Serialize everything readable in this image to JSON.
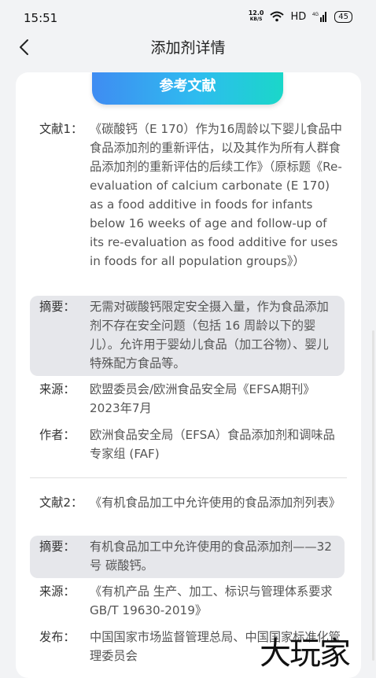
{
  "status": {
    "time": "15:51",
    "speed_top": "12.0",
    "speed_bottom": "KB/S",
    "hd": "HD",
    "net": "4G",
    "battery": "45"
  },
  "header": {
    "title": "添加剂详情"
  },
  "section": {
    "title": "参考文献"
  },
  "refs": [
    {
      "label": "文献1：",
      "text": "《碳酸钙（E 170）作为16周龄以下婴儿食品中食品添加剂的重新评估，以及其作为所有人群食品添加剂的重新评估的后续工作》（原标题《Re-evaluation of calcium carbonate (E 170) as a food additive in foods for infants below 16 weeks of age and follow-up of its re-evaluation as food additive for uses in foods for all population groups》）",
      "summary_label": "摘要：",
      "summary": "无需对碳酸钙限定安全摄入量，作为食品添加剂不存在安全问题（包括 16 周龄以下的婴儿）。允许用于婴幼儿食品（加工谷物）、婴儿特殊配方食品等。",
      "source_label": "来源：",
      "source": "欧盟委员会/欧洲食品安全局《EFSA期刊》2023年7月",
      "author_label": "作者：",
      "author": "欧洲食品安全局（EFSA）食品添加剂和调味品专家组 (FAF)"
    },
    {
      "label": "文献2：",
      "text": "《有机食品加工中允许使用的食品添加剂列表》",
      "summary_label": "摘要：",
      "summary": "有机食品加工中允许使用的食品添加剂——32号 碳酸钙。",
      "source_label": "来源：",
      "source": "《有机产品 生产、加工、标识与管理体系要求 GB/T 19630-2019》",
      "publisher_label": "发布：",
      "publisher": "中国国家市场监督管理总局、中国国家标准化管理委员会"
    }
  ],
  "watermark": "大玩家"
}
